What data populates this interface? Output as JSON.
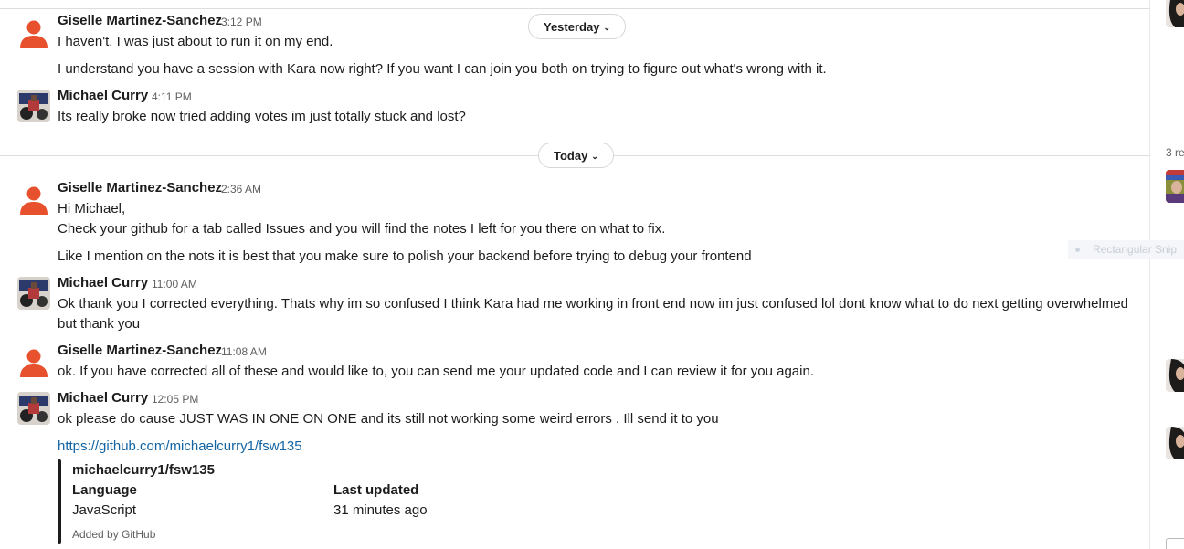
{
  "day_dividers": [
    "Yesterday",
    "Today"
  ],
  "messages": [
    {
      "name": "Giselle Martinez-Sanchez",
      "time": "3:12 PM",
      "lines": [
        "I haven't. I was just about to run it on my end.",
        "I understand you have a session with Kara now right? If you want I can join you both on trying to figure out what's wrong with it."
      ]
    },
    {
      "name": "Michael Curry",
      "time": "4:11 PM",
      "lines": [
        "Its really broke now tried adding votes im just totally stuck and lost?"
      ]
    },
    {
      "name": "Giselle Martinez-Sanchez",
      "time": "2:36 AM",
      "lines": [
        "Hi Michael,",
        "Check your github for a tab called Issues and you will find the notes I left for you there on what to fix.",
        "Like I mention on the nots it is best that you make sure to polish your backend before trying to debug your frontend"
      ]
    },
    {
      "name": "Michael Curry",
      "time": "11:00 AM",
      "lines": [
        "Ok thank you I corrected everything. Thats why im so confused I think Kara had me working in front end now im just confused lol dont know what to do next getting overwhelmed",
        "but thank you"
      ]
    },
    {
      "name": "Giselle Martinez-Sanchez",
      "time": "11:08 AM",
      "lines": [
        "ok. If you have corrected all of these and would like to, you can send me your updated code and I can review it for you again."
      ]
    },
    {
      "name": "Michael Curry",
      "time": "12:05 PM",
      "lines": [
        "ok please do cause JUST WAS IN ONE ON ONE and its still not working some weird errors . Ill send it to you"
      ],
      "link": "https://github.com/michaelcurry1/fsw135"
    }
  ],
  "unfurl": {
    "title": "michaelcurry1/fsw135",
    "fields": [
      {
        "label": "Language",
        "value": "JavaScript"
      },
      {
        "label": "Last updated",
        "value": "31 minutes ago"
      }
    ],
    "footer": "Added by GitHub"
  },
  "side_panel": {
    "reply_count_fragment": "3 re",
    "tooltip": "Rectangular Snip"
  },
  "icons": {
    "day_chevron": "chevron-down-icon",
    "default_avatar": "person-avatar-icon",
    "photo_avatar": "photo-avatar"
  },
  "colors": {
    "default_avatar": "#e8512d",
    "link": "#1264a3",
    "text": "#1d1c1d",
    "muted": "#616061"
  }
}
